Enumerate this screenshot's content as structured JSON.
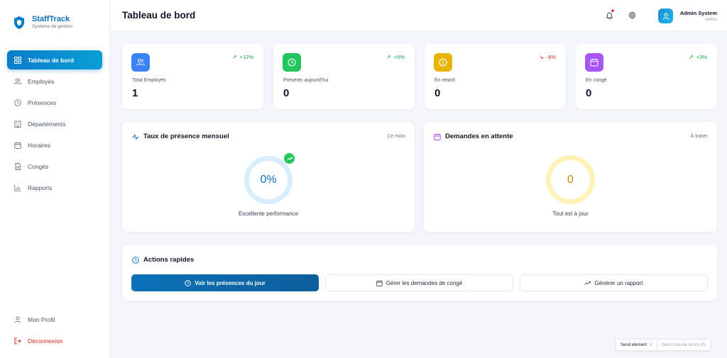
{
  "brand": {
    "name": "StaffTrack",
    "subtitle": "Système de gestion"
  },
  "sidebar": {
    "items": [
      {
        "label": "Tableau de bord",
        "icon": "dashboard-icon",
        "active": true
      },
      {
        "label": "Employés",
        "icon": "users-icon"
      },
      {
        "label": "Présences",
        "icon": "clock-icon"
      },
      {
        "label": "Départements",
        "icon": "building-icon"
      },
      {
        "label": "Horaires",
        "icon": "calendar-icon"
      },
      {
        "label": "Congés",
        "icon": "document-icon"
      },
      {
        "label": "Rapports",
        "icon": "bar-chart-icon"
      }
    ],
    "bottom": [
      {
        "label": "Mon Profil",
        "icon": "user-icon"
      },
      {
        "label": "Déconnexion",
        "icon": "logout-icon"
      }
    ]
  },
  "header": {
    "title": "Tableau de bord",
    "user": {
      "name": "Admin System",
      "role": "Admin"
    }
  },
  "stats": [
    {
      "label": "Total Employés",
      "value": "1",
      "trend": "+12%",
      "trend_dir": "up",
      "color": "#3b82f6",
      "icon": "users-icon"
    },
    {
      "label": "Présents aujourd'hui",
      "value": "0",
      "trend": "+5%",
      "trend_dir": "up",
      "color": "#22c55e",
      "icon": "clock-icon"
    },
    {
      "label": "En retard",
      "value": "0",
      "trend": "-8%",
      "trend_dir": "down",
      "color": "#eab308",
      "icon": "alert-icon"
    },
    {
      "label": "En congé",
      "value": "0",
      "trend": "+3%",
      "trend_dir": "up",
      "color": "#a855f7",
      "icon": "calendar-icon"
    }
  ],
  "attendance": {
    "title": "Taux de présence mensuel",
    "period": "Ce mois",
    "value": "0%",
    "caption": "Excellente performance"
  },
  "requests": {
    "title": "Demandes en attente",
    "meta": "À traiter",
    "value": "0",
    "caption": "Tout est à jour"
  },
  "quick_actions": {
    "title": "Actions rapides",
    "buttons": [
      {
        "label": "Voir les présences du jour",
        "icon": "clock-icon"
      },
      {
        "label": "Gérer les demandes de congé",
        "icon": "calendar-icon"
      },
      {
        "label": "Générer un rapport",
        "icon": "trending-up-icon"
      }
    ]
  },
  "devbar": {
    "send_element": "Send element",
    "send_errors": "Send console errors (0)"
  },
  "colors": {
    "accent": "#0b7dc8",
    "danger": "#dc2626",
    "success": "#16a34a"
  }
}
